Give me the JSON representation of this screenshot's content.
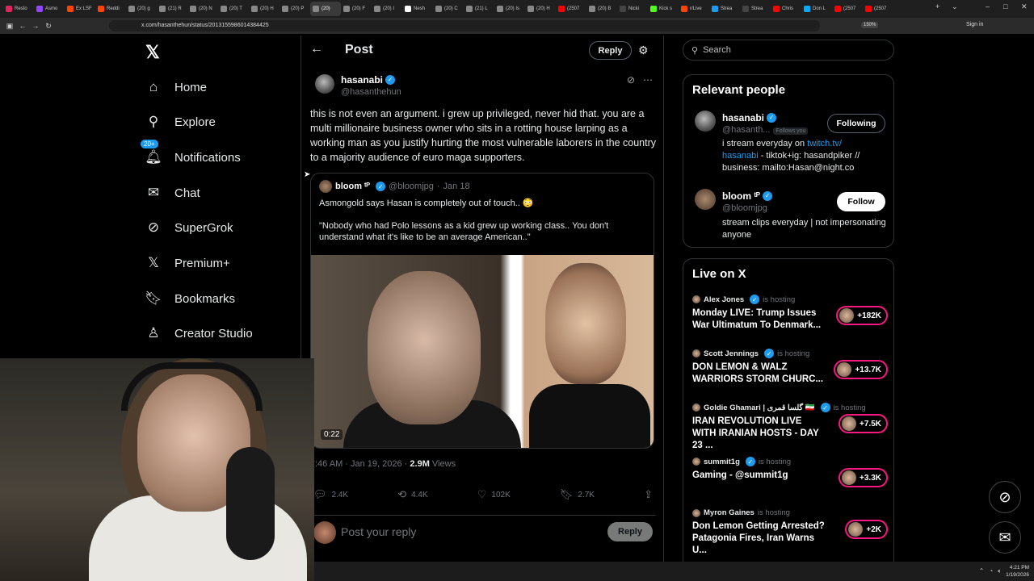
{
  "browser": {
    "tabs": [
      "Resto",
      "Asmo",
      "Ex LSF",
      "Reddi",
      "(20) g",
      "(21) R",
      "(20) N",
      "(20) T",
      "(20) H",
      "(20) P",
      "(20)",
      "(20) F",
      "(20) I",
      "Nesh",
      "(20) C",
      "(21) L",
      "(20) Is",
      "(20) H",
      "(2507",
      "(20) B",
      "Nicki",
      "Kick s",
      "r/Live",
      "Strea",
      "Strea",
      "Chris",
      "Don L",
      "(2507",
      "(2507"
    ],
    "active_tab_index": 10,
    "url": "x.com/hasanthehun/status/2013155986014384425",
    "zoom": "150%",
    "sign_in": "Sign in"
  },
  "nav": {
    "items": [
      {
        "label": "Home",
        "icon": "home-icon"
      },
      {
        "label": "Explore",
        "icon": "search-icon"
      },
      {
        "label": "Notifications",
        "icon": "bell-icon",
        "badge": "20+"
      },
      {
        "label": "Chat",
        "icon": "mail-icon"
      },
      {
        "label": "SuperGrok",
        "icon": "grok-icon"
      },
      {
        "label": "Premium+",
        "icon": "x-icon"
      },
      {
        "label": "Bookmarks",
        "icon": "bookmark-icon"
      },
      {
        "label": "Creator Studio",
        "icon": "creator-icon"
      }
    ]
  },
  "header": {
    "title": "Post",
    "reply_label": "Reply"
  },
  "post": {
    "name": "hasanabi",
    "handle": "@hasanthehun",
    "text": "this is not even an argument. i grew up privileged, never hid that. you are a multi millionaire business owner who sits in a rotting house larping as a working man as you justify hurting the most vulnerable laborers in the country to a majority audience of euro maga supporters.",
    "quote": {
      "name": "bloom ᵗᴾ",
      "handle": "@bloomjpg",
      "date": "Jan 18",
      "line1": "Asmongold says Hasan is completely out of touch.. 😳",
      "line2": "\"Nobody who had Polo lessons as a kid grew up working class.. You don't understand what it's like to be an average American..\"",
      "video_time": "0:22"
    },
    "time": ":46 AM · Jan 19, 2026 · ",
    "views_count": "2.9M",
    "views_label": " Views",
    "stats": {
      "replies": "2.4K",
      "reposts": "4.4K",
      "likes": "102K",
      "bookmarks": "2.7K"
    },
    "reply_placeholder": "Post your reply",
    "reply_button": "Reply"
  },
  "sidebar": {
    "search_placeholder": "Search",
    "relevant_title": "Relevant people",
    "people": [
      {
        "name": "hasanabi",
        "handle": "@hasanth...",
        "follows_you": "Follows you",
        "button": "Following",
        "bio_pre": "i stream everyday on ",
        "bio_link1": "twitch.tv/",
        "bio_link2": "hasanabi",
        "bio_post": " - tiktok+ig: hasandpiker // business: mailto:Hasan@night.co"
      },
      {
        "name": "bloom ᵗᴾ",
        "handle": "@bloomjpg",
        "button": "Follow",
        "bio": "stream clips everyday | not impersonating anyone"
      }
    ],
    "live_title": "Live on X",
    "live": [
      {
        "host": "Alex Jones",
        "status": "is hosting",
        "title": "Monday LIVE: Trump Issues War Ultimatum To Denmark...",
        "count": "+182K"
      },
      {
        "host": "Scott Jennings",
        "status": "is hosting",
        "title": "DON LEMON & WALZ WARRIORS STORM CHURC...",
        "count": "+13.7K"
      },
      {
        "host": "Goldie Ghamari | گلسا قمری 🇮🇷",
        "status": "is hosting",
        "title": "IRAN REVOLUTION LIVE WITH IRANIAN HOSTS - DAY 23 ...",
        "count": "+7.5K"
      },
      {
        "host": "summit1g",
        "status": "is hosting",
        "title": "Gaming - @summit1g",
        "count": "+3.3K"
      },
      {
        "host": "Myron Gaines",
        "status": "is hosting",
        "title": "Don Lemon Getting Arrested? Patagonia Fires, Iran Warns U...",
        "count": "+2K"
      }
    ]
  },
  "taskbar": {
    "time": "4:21 PM",
    "date": "1/19/2026"
  },
  "colors": {
    "accent": "#1d9bf0",
    "live": "#f91880",
    "bg": "#000000"
  }
}
